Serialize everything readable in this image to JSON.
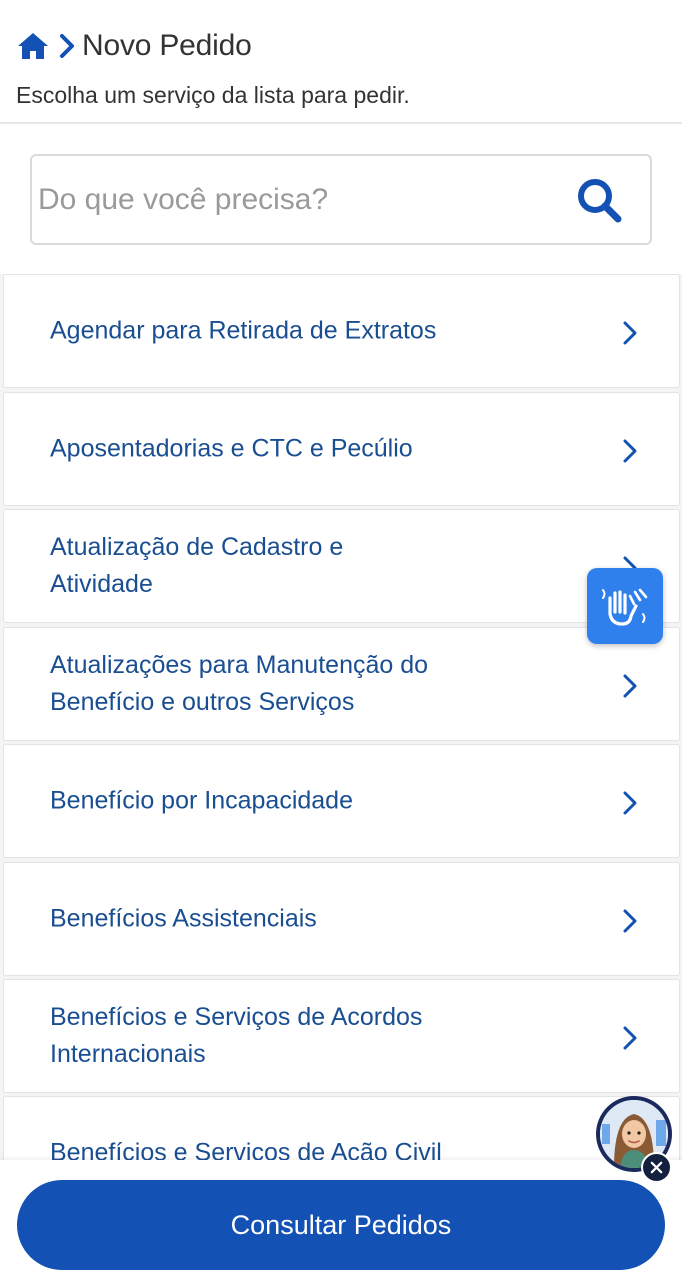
{
  "header": {
    "title": "Novo Pedido",
    "subtitle": "Escolha um serviço da lista para pedir."
  },
  "search": {
    "placeholder": "Do que você precisa?",
    "value": ""
  },
  "services": [
    {
      "label": "Agendar para Retirada de Extratos"
    },
    {
      "label": "Aposentadorias e CTC e Pecúlio"
    },
    {
      "label": "Atualização de Cadastro e Atividade"
    },
    {
      "label": "Atualizações para Manutenção do Benefício e outros Serviços"
    },
    {
      "label": "Benefício por Incapacidade"
    },
    {
      "label": "Benefícios Assistenciais"
    },
    {
      "label": "Benefícios e Serviços de Acordos Internacionais"
    },
    {
      "label": "Benefícios e Serviços de Ação Civil"
    }
  ],
  "footer": {
    "button_label": "Consultar Pedidos"
  },
  "icons": {
    "home": "home-icon",
    "breadcrumb_separator": "chevron-right-icon",
    "search": "search-icon",
    "item_arrow": "chevron-right-icon",
    "accessibility": "sign-language-icon",
    "assistant": "assistant-avatar",
    "close": "close-icon"
  },
  "colors": {
    "primary": "#1351b4",
    "link": "#1a4e92",
    "libras": "#2f80ed",
    "text": "#333333",
    "placeholder": "#9a9a9a",
    "background": "#f3f4f6"
  }
}
